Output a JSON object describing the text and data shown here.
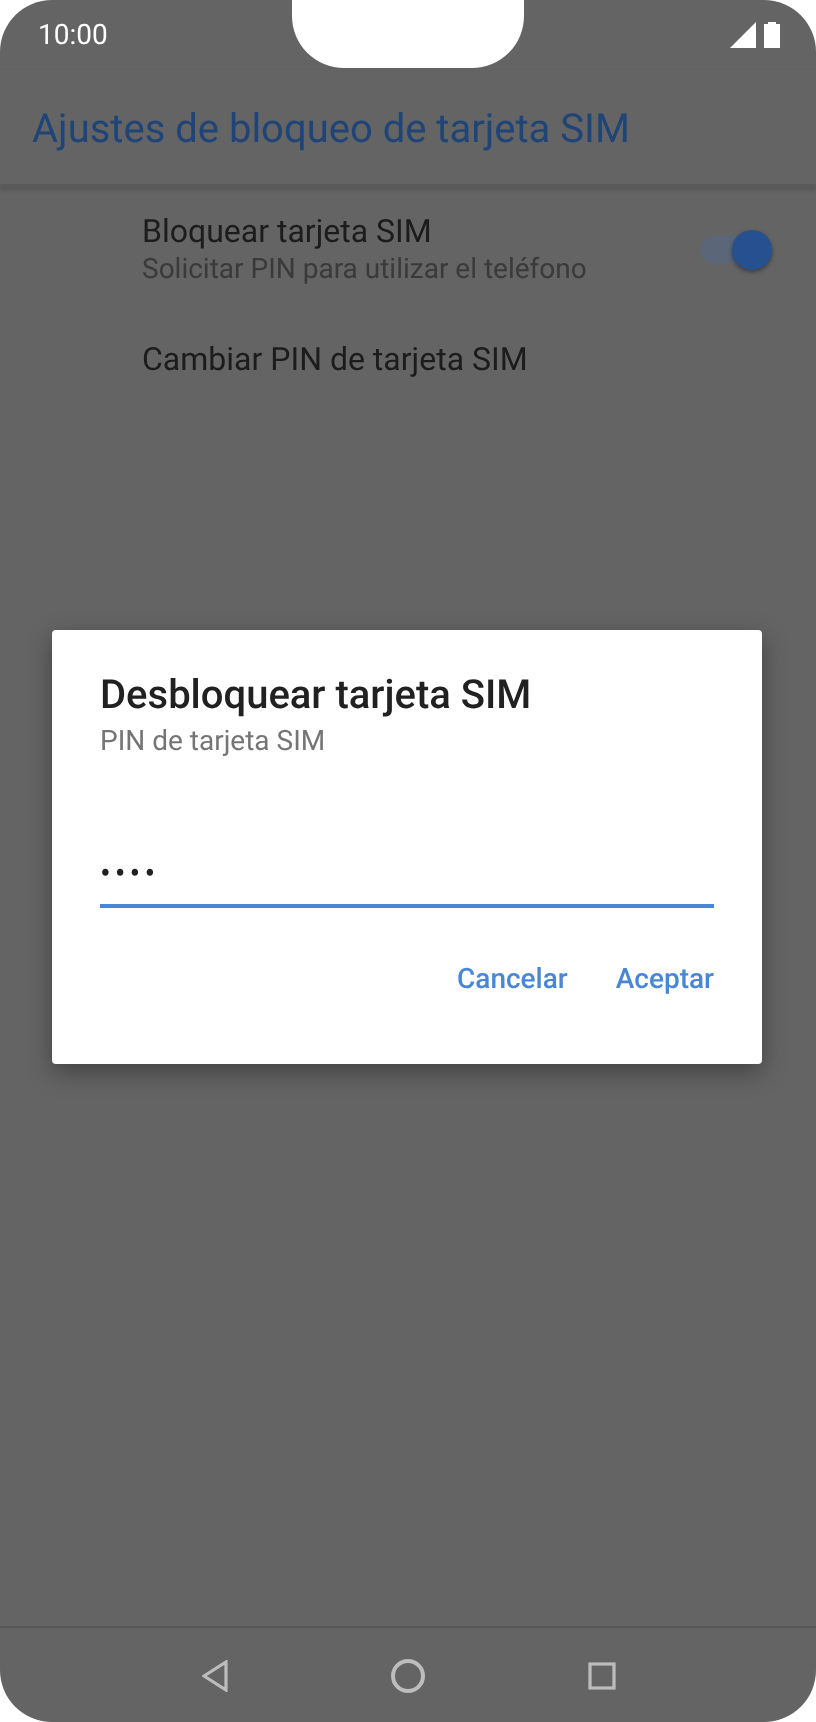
{
  "status_bar": {
    "time": "10:00"
  },
  "app_bar": {
    "title": "Ajustes de bloqueo de tarjeta SIM"
  },
  "settings": [
    {
      "kind": "switch",
      "title": "Bloquear tarjeta SIM",
      "summary": "Solicitar PIN para utilizar el teléfono",
      "on": true
    },
    {
      "kind": "plain",
      "title": "Cambiar PIN de tarjeta SIM"
    }
  ],
  "dialog": {
    "title": "Desbloquear tarjeta SIM",
    "message": "PIN de tarjeta SIM",
    "pin_field": {
      "value": "••••"
    },
    "buttons": [
      "Cancelar",
      "Aceptar"
    ]
  }
}
